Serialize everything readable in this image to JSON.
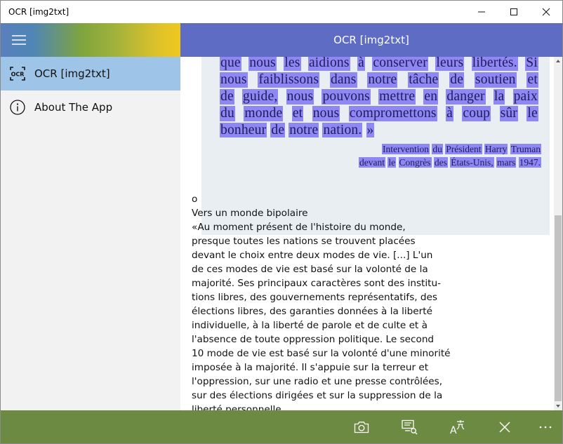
{
  "window": {
    "title": "OCR [img2txt]"
  },
  "header": {
    "title": "OCR [img2txt]"
  },
  "sidebar": {
    "items": [
      {
        "label": "OCR [img2txt]",
        "icon": "ocr-icon",
        "active": true
      },
      {
        "label": "About The App",
        "icon": "info-icon",
        "active": false
      }
    ]
  },
  "scan": {
    "lines": [
      [
        "que",
        "nous",
        "les",
        "aidions",
        "à",
        "conserver",
        "leurs",
        "libertés.",
        "Si"
      ],
      [
        "nous",
        "faiblissons",
        "dans",
        "notre",
        "tâche",
        "de",
        "soutien",
        "et"
      ],
      [
        "de",
        "guide,",
        "nous",
        "pouvons",
        "mettre",
        "en",
        "danger",
        "la",
        "paix"
      ],
      [
        "du",
        "monde",
        "et",
        "nous",
        "compromettons",
        "à",
        "coup",
        "sûr",
        "le"
      ],
      [
        "bonheur",
        "de",
        "notre",
        "nation.",
        "»"
      ]
    ],
    "citation": [
      [
        "Intervention",
        "du",
        "Président",
        "Harry",
        "Truman"
      ],
      [
        "devant",
        "le",
        "Congrès",
        "des",
        "États-Unis,",
        "mars",
        "1947."
      ]
    ]
  },
  "ocr_text": {
    "lines": [
      "o",
      "Vers un monde bipolaire",
      "«Au moment présent de l'histoire du monde,",
      "presque toutes les nations se trouvent placées",
      "devant le choix entre deux modes de vie. [...] L'un",
      "de ces modes de vie est basé sur la volonté de la",
      "majorité. Ses principaux caractères sont des institu-",
      "tions libres, des gouvernements représentatifs, des",
      "élections libres, des garanties données à la liberté",
      "individuelle, à la liberté de parole et de culte et à",
      "l'absence de toute oppression politique. Le second",
      "10 mode de vie est basé sur la volonté d'une minorité",
      "imposée à la majorité. Il s'appuie sur la terreur et",
      "l'oppression, sur une radio et une presse contrôlées,",
      "sur des élections dirigées et sur la suppression de la",
      "liberté personnelle."
    ]
  },
  "commandbar": {
    "buttons": [
      "camera-icon",
      "scan-image-icon",
      "translate-icon",
      "clear-icon",
      "more-icon"
    ]
  },
  "colors": {
    "header": "#5e6cc4",
    "sidebar_active": "#9ec5e8",
    "commandbar": "#6d8a43",
    "highlight": "#8f87f3"
  }
}
